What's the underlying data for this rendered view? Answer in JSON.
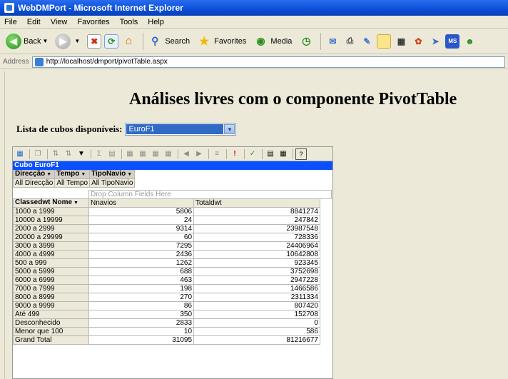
{
  "window": {
    "title": "WebDMPort - Microsoft Internet Explorer"
  },
  "menu": [
    "File",
    "Edit",
    "View",
    "Favorites",
    "Tools",
    "Help"
  ],
  "toolbar": {
    "back": "Back",
    "search": "Search",
    "favorites": "Favorites",
    "media": "Media"
  },
  "address": {
    "label": "Address",
    "url": "http://localhost/dmport/pivotTable.aspx"
  },
  "page": {
    "title": "Análises livres com o componente PivotTable",
    "cube_label": "Lista de cubos disponíveis:",
    "cube_selected": "EuroF1"
  },
  "pivot": {
    "caption": "Cubo EuroF1",
    "filter_fields": [
      {
        "name": "Direcção",
        "value": "All Direcção"
      },
      {
        "name": "Tempo",
        "value": "All Tempo"
      },
      {
        "name": "TipoNavio",
        "value": "All TipoNavio"
      }
    ],
    "drop_hint": "Drop Column Fields Here",
    "row_field": "Classedwt Nome",
    "data_fields": [
      "Nnavios",
      "Totaldwt"
    ],
    "rows": [
      {
        "label": "1000 a 1999",
        "n": "5806",
        "t": "8841274"
      },
      {
        "label": "10000 a 19999",
        "n": "24",
        "t": "247842"
      },
      {
        "label": "2000 a 2999",
        "n": "9314",
        "t": "23987548"
      },
      {
        "label": "20000 a 29999",
        "n": "60",
        "t": "728336"
      },
      {
        "label": "3000 a 3999",
        "n": "7295",
        "t": "24406964"
      },
      {
        "label": "4000 a 4999",
        "n": "2436",
        "t": "10642808"
      },
      {
        "label": "500 a 999",
        "n": "1262",
        "t": "923345"
      },
      {
        "label": "5000 a 5999",
        "n": "688",
        "t": "3752698"
      },
      {
        "label": "6000 a 6999",
        "n": "463",
        "t": "2947228"
      },
      {
        "label": "7000 a 7999",
        "n": "198",
        "t": "1466586"
      },
      {
        "label": "8000 a 8999",
        "n": "270",
        "t": "2311334"
      },
      {
        "label": "9000 a 9999",
        "n": "86",
        "t": "807420"
      },
      {
        "label": "Até 499",
        "n": "350",
        "t": "152708"
      },
      {
        "label": "Desconhecido",
        "n": "2833",
        "t": "0"
      },
      {
        "label": "Menor que 100",
        "n": "10",
        "t": "586"
      },
      {
        "label": "Grand Total",
        "n": "31095",
        "t": "81216677"
      }
    ]
  }
}
